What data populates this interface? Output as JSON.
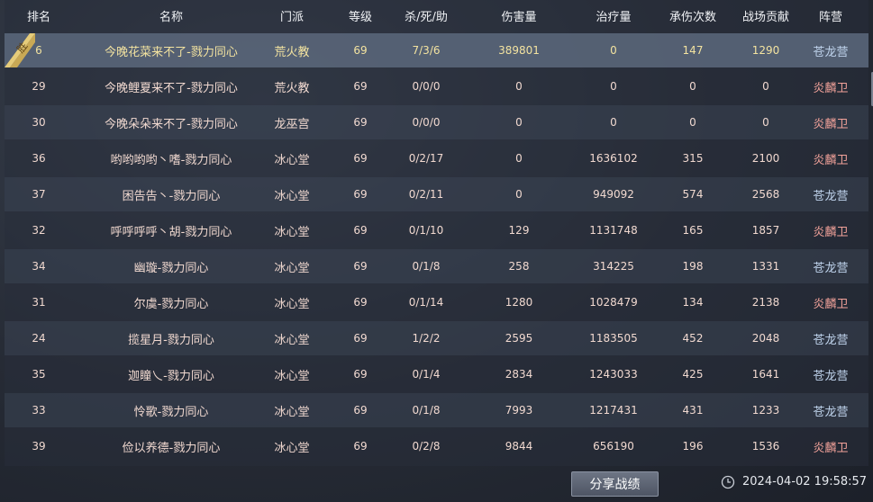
{
  "columns": {
    "rank": "排名",
    "name": "名称",
    "school": "门派",
    "level": "等级",
    "kda": "杀/死/助",
    "damage": "伤害量",
    "healing": "治疗量",
    "hits_taken": "承伤次数",
    "contribution": "战场贡献",
    "camp": "阵营"
  },
  "win_badge": "胜",
  "rows": [
    {
      "rank": "6",
      "name": "今晚花菜来不了-戮力同心",
      "school": "荒火教",
      "level": "69",
      "kda": "7/3/6",
      "damage": "389801",
      "healing": "0",
      "hits": "147",
      "contrib": "1290",
      "camp": "苍龙营"
    },
    {
      "rank": "29",
      "name": "今晚鲤夏来不了-戮力同心",
      "school": "荒火教",
      "level": "69",
      "kda": "0/0/0",
      "damage": "0",
      "healing": "0",
      "hits": "0",
      "contrib": "0",
      "camp": "炎麟卫"
    },
    {
      "rank": "30",
      "name": "今晚朵朵来不了-戮力同心",
      "school": "龙巫宫",
      "level": "69",
      "kda": "0/0/0",
      "damage": "0",
      "healing": "0",
      "hits": "0",
      "contrib": "0",
      "camp": "炎麟卫"
    },
    {
      "rank": "36",
      "name": "哟哟哟哟丶嗜-戮力同心",
      "school": "冰心堂",
      "level": "69",
      "kda": "0/2/17",
      "damage": "0",
      "healing": "1636102",
      "hits": "315",
      "contrib": "2100",
      "camp": "炎麟卫"
    },
    {
      "rank": "37",
      "name": "困告告丶-戮力同心",
      "school": "冰心堂",
      "level": "69",
      "kda": "0/2/11",
      "damage": "0",
      "healing": "949092",
      "hits": "574",
      "contrib": "2568",
      "camp": "苍龙营"
    },
    {
      "rank": "32",
      "name": "呼呼呼呼丶胡-戮力同心",
      "school": "冰心堂",
      "level": "69",
      "kda": "0/1/10",
      "damage": "129",
      "healing": "1131748",
      "hits": "165",
      "contrib": "1857",
      "camp": "炎麟卫"
    },
    {
      "rank": "34",
      "name": "幽璇-戮力同心",
      "school": "冰心堂",
      "level": "69",
      "kda": "0/1/8",
      "damage": "258",
      "healing": "314225",
      "hits": "198",
      "contrib": "1331",
      "camp": "苍龙营"
    },
    {
      "rank": "31",
      "name": "尔虞-戮力同心",
      "school": "冰心堂",
      "level": "69",
      "kda": "0/1/14",
      "damage": "1280",
      "healing": "1028479",
      "hits": "134",
      "contrib": "2138",
      "camp": "炎麟卫"
    },
    {
      "rank": "24",
      "name": "揽星月-戮力同心",
      "school": "冰心堂",
      "level": "69",
      "kda": "1/2/2",
      "damage": "2595",
      "healing": "1183505",
      "hits": "452",
      "contrib": "2048",
      "camp": "苍龙营"
    },
    {
      "rank": "35",
      "name": "迦瞳乀-戮力同心",
      "school": "冰心堂",
      "level": "69",
      "kda": "0/1/4",
      "damage": "2834",
      "healing": "1243033",
      "hits": "425",
      "contrib": "1641",
      "camp": "苍龙营"
    },
    {
      "rank": "33",
      "name": "怜歌-戮力同心",
      "school": "冰心堂",
      "level": "69",
      "kda": "0/1/8",
      "damage": "7993",
      "healing": "1217431",
      "hits": "431",
      "contrib": "1233",
      "camp": "苍龙营"
    },
    {
      "rank": "39",
      "name": "俭以养德-戮力同心",
      "school": "冰心堂",
      "level": "69",
      "kda": "0/2/8",
      "damage": "9844",
      "healing": "656190",
      "hits": "196",
      "contrib": "1536",
      "camp": "炎麟卫"
    }
  ],
  "camp_colors": {
    "苍龙营": "#bfd3ec",
    "炎麟卫": "#f2a29a"
  },
  "share_button": "分享战绩",
  "datetime": "2024-04-02  19:58:57",
  "icons": {
    "clock": "clock-icon",
    "badge": "win-badge-icon"
  }
}
